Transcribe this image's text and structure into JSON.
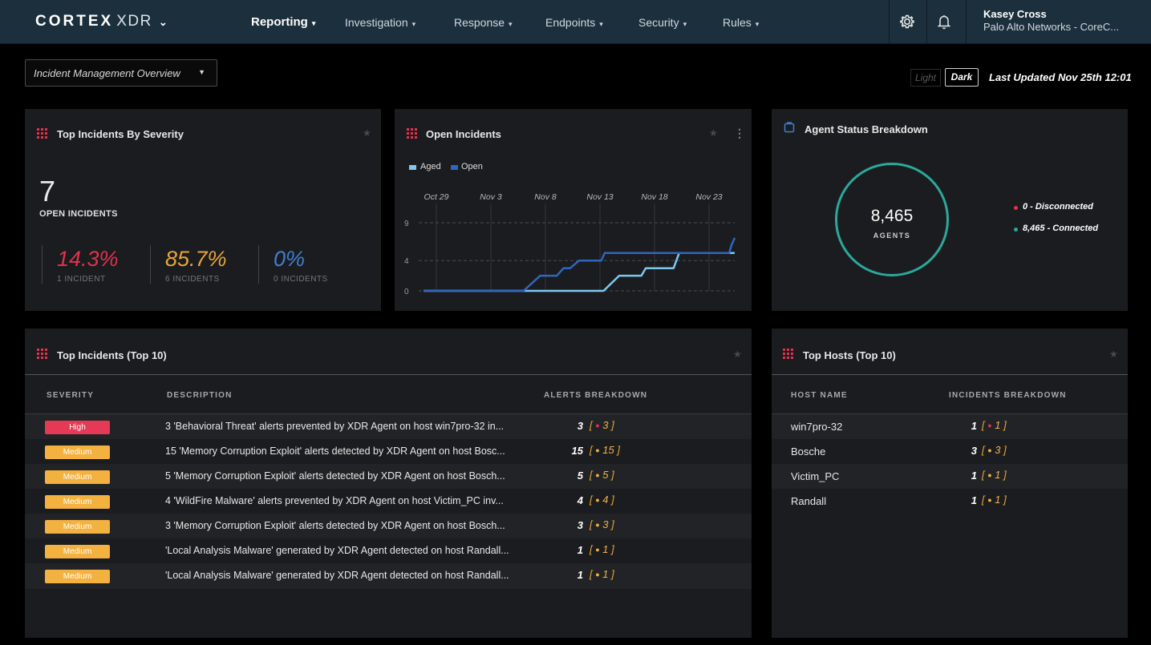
{
  "nav": {
    "brand": "CORTEX",
    "product": "XDR",
    "brand_chevron": "⌄",
    "items": [
      {
        "label": "Reporting",
        "active": true
      },
      {
        "label": "Investigation",
        "active": false
      },
      {
        "label": "Response",
        "active": false
      },
      {
        "label": "Endpoints",
        "active": false
      },
      {
        "label": "Security",
        "active": false
      },
      {
        "label": "Rules",
        "active": false
      }
    ],
    "icons": [
      "gear-icon",
      "bell-icon"
    ],
    "user_name": "Kasey Cross",
    "user_org": "Palo Alto Networks - CoreC..."
  },
  "toolbar": {
    "dashboard": "Incident Management Overview",
    "theme_light": "Light",
    "theme_dark": "Dark",
    "last_updated": "Last Updated Nov 25th 12:01"
  },
  "severity_widget": {
    "title": "Top Incidents By Severity",
    "total": "7",
    "total_label": "OPEN INCIDENTS",
    "blocks": [
      {
        "pct": "14.3%",
        "sub": "1 INCIDENT",
        "color": "#e0324d"
      },
      {
        "pct": "85.7%",
        "sub": "6 INCIDENTS",
        "color": "#e8a53a"
      },
      {
        "pct": "0%",
        "sub": "0 INCIDENTS",
        "color": "#3f7fd1"
      }
    ]
  },
  "open_incidents_widget": {
    "title": "Open Incidents",
    "menu_icon": "⋮"
  },
  "chart_data": {
    "type": "line",
    "title": "Open Incidents",
    "x_ticks": [
      "Oct 29",
      "Nov 3",
      "Nov 8",
      "Nov 13",
      "Nov 18",
      "Nov 23"
    ],
    "y_ticks": [
      0,
      4,
      9
    ],
    "ylim": [
      0,
      9
    ],
    "xlim": [
      0,
      28
    ],
    "x_axis_position": "top",
    "legend_position": "top-left",
    "grid": "dashed horizontal, solid vertical",
    "series": [
      {
        "name": "Aged",
        "color": "#7ec8ee",
        "points": [
          [
            0,
            0
          ],
          [
            16.2,
            0
          ],
          [
            17.6,
            2
          ],
          [
            19.6,
            2
          ],
          [
            20,
            3
          ],
          [
            22.5,
            3
          ],
          [
            23,
            5
          ],
          [
            28,
            5
          ]
        ]
      },
      {
        "name": "Open",
        "color": "#2f66bf",
        "points": [
          [
            0,
            0
          ],
          [
            9,
            0
          ],
          [
            10.5,
            2
          ],
          [
            12,
            2
          ],
          [
            12.6,
            3
          ],
          [
            13.2,
            3
          ],
          [
            14,
            4
          ],
          [
            16,
            4
          ],
          [
            16.3,
            5
          ],
          [
            22,
            5
          ],
          [
            22.6,
            5
          ],
          [
            27.5,
            5
          ],
          [
            27.7,
            6
          ],
          [
            28,
            7
          ]
        ]
      }
    ]
  },
  "agent_widget": {
    "title": "Agent Status Breakdown",
    "total": "8,465",
    "total_label": "AGENTS",
    "legend": [
      {
        "label": "0 - Disconnected",
        "color": "#e0324d"
      },
      {
        "label": "8,465 - Connected",
        "color": "#2ba89c"
      }
    ]
  },
  "top_incidents": {
    "title": "Top Incidents (Top 10)",
    "columns": [
      "SEVERITY",
      "DESCRIPTION",
      "ALERTS BREAKDOWN"
    ],
    "rows": [
      {
        "severity": "High",
        "color": "#e53a55",
        "description": "3 'Behavioral Threat' alerts prevented by XDR Agent on host win7pro-32 in...",
        "count": "3",
        "breakdown": "3",
        "dot": "#e0324d"
      },
      {
        "severity": "Medium",
        "color": "#f3b13f",
        "description": "15 'Memory Corruption Exploit' alerts detected by XDR Agent on host Bosc...",
        "count": "15",
        "breakdown": "15",
        "dot": "#f3b13f"
      },
      {
        "severity": "Medium",
        "color": "#f3b13f",
        "description": "5 'Memory Corruption Exploit' alerts detected by XDR Agent on host Bosch...",
        "count": "5",
        "breakdown": "5",
        "dot": "#f3b13f"
      },
      {
        "severity": "Medium",
        "color": "#f3b13f",
        "description": "4 'WildFire Malware' alerts prevented by XDR Agent on host Victim_PC inv...",
        "count": "4",
        "breakdown": "4",
        "dot": "#f3b13f"
      },
      {
        "severity": "Medium",
        "color": "#f3b13f",
        "description": "3 'Memory Corruption Exploit' alerts detected by XDR Agent on host Bosch...",
        "count": "3",
        "breakdown": "3",
        "dot": "#f3b13f"
      },
      {
        "severity": "Medium",
        "color": "#f3b13f",
        "description": "'Local Analysis Malware' generated by XDR Agent detected on host Randall...",
        "count": "1",
        "breakdown": "1",
        "dot": "#f3b13f"
      },
      {
        "severity": "Medium",
        "color": "#f3b13f",
        "description": "'Local Analysis Malware' generated by XDR Agent detected on host Randall...",
        "count": "1",
        "breakdown": "1",
        "dot": "#f3b13f"
      }
    ]
  },
  "top_hosts": {
    "title": "Top Hosts (Top 10)",
    "columns": [
      "HOST NAME",
      "INCIDENTS BREAKDOWN"
    ],
    "rows": [
      {
        "host": "win7pro-32",
        "count": "1",
        "breakdown": "1",
        "dot": "#e0324d"
      },
      {
        "host": "Bosche",
        "count": "3",
        "breakdown": "3",
        "dot": "#f3b13f"
      },
      {
        "host": "Victim_PC",
        "count": "1",
        "breakdown": "1",
        "dot": "#f3b13f"
      },
      {
        "host": "Randall",
        "count": "1",
        "breakdown": "1",
        "dot": "#f3b13f"
      }
    ]
  },
  "colors": {
    "nav_bg": "#1c2f3c",
    "panel_bg": "#1b1c1f",
    "accent_pink": "#e0324d",
    "accent_teal": "#2ba89c"
  }
}
